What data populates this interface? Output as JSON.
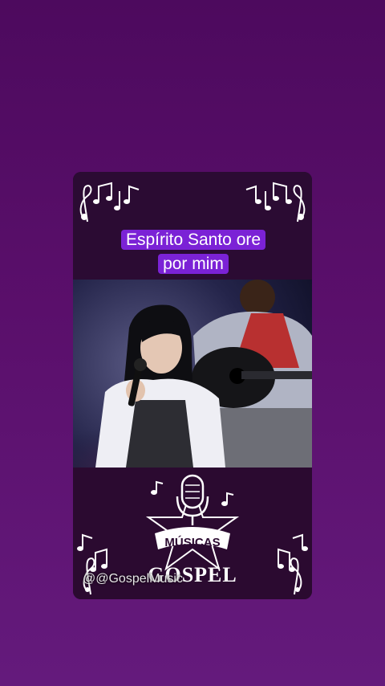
{
  "caption": {
    "line1": "Espírito Santo ore",
    "line2": "por mim"
  },
  "logo": {
    "top_text": "MÚSICAS",
    "bottom_text": "GOSPEL"
  },
  "watermark": "@@GospelMusic",
  "colors": {
    "background": "#560f68",
    "caption_bg": "#7b22d6",
    "card_bg": "#2a0a2e"
  }
}
